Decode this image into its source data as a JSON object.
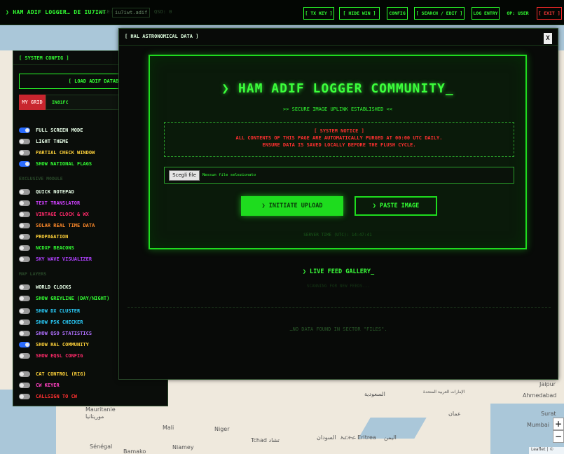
{
  "topbar": {
    "brand": "❯ HAM ADIF LOGGER… DE IU7IWT",
    "file": "iu7iwt.adif",
    "dim_left": "FILE:",
    "dim_right": "QSO: 0",
    "buttons": [
      "[ TX KEY ]",
      "[ HIDE WIN ]",
      "CONFIG",
      "[ SEARCH / EDIT ]",
      "LOG ENTRY",
      "OP: USER",
      "[ EXIT ]"
    ],
    "colors": {
      "accent": "#33ff33",
      "exit": "#ff3a3a"
    }
  },
  "config": {
    "title": "[ SYSTEM CONFIG ]",
    "load_db": "[ LOAD ADIF DATABASE",
    "grid_label": "MY GRID",
    "grid_value": "IN81FC",
    "group1": [
      {
        "label": "FULL SCREEN MODE",
        "on": true,
        "color": "#e8ffe8"
      },
      {
        "label": "LIGHT THEME",
        "on": false,
        "color": "#e8ffe8"
      },
      {
        "label": "PARTIAL CHECK WINDOW",
        "on": false,
        "color": "#ffd23a"
      },
      {
        "label": "SHOW NATIONAL FLAGS",
        "on": true,
        "color": "#33ff33"
      }
    ],
    "section2": "EXCLUSIVE MODULE",
    "group2": [
      {
        "label": "QUICK NOTEPAD",
        "on": false,
        "color": "#e8ffe8"
      },
      {
        "label": "TEXT TRANSLATOR",
        "on": false,
        "color": "#d040ff"
      },
      {
        "label": "VINTAGE CLOCK & WX",
        "on": false,
        "color": "#ff2a6a"
      },
      {
        "label": "SOLAR REAL TIME DATA",
        "on": false,
        "color": "#ff8a2a"
      },
      {
        "label": "PROPAGATION",
        "on": false,
        "color": "#ffd23a"
      },
      {
        "label": "NCDXF BEACONS",
        "on": false,
        "color": "#33ff33"
      },
      {
        "label": "SKY WAVE VISUALIZER",
        "on": false,
        "color": "#b040ff"
      }
    ],
    "section3": "MAP LAYERS",
    "group3": [
      {
        "label": "WORLD CLOCKS",
        "on": false,
        "color": "#e8ffe8"
      },
      {
        "label": "SHOW GREYLINE (DAY/NIGHT)",
        "on": false,
        "color": "#33ff33"
      }
    ],
    "group4": [
      {
        "label": "SHOW DX CLUSTER",
        "on": false,
        "color": "#2ad0ff"
      },
      {
        "label": "SHOW PSK CHECKER",
        "on": false,
        "color": "#2ad0ff"
      },
      {
        "label": "SHOW QSO STATISTICS",
        "on": false,
        "color": "#b070ff"
      },
      {
        "label": "SHOW HAL COMMUNITY",
        "on": true,
        "color": "#ffd23a"
      },
      {
        "label": "SHOW EQSL CONFIG",
        "on": false,
        "color": "#ff2a6a"
      }
    ],
    "group5": [
      {
        "label": "CAT CONTROL (RIG)",
        "on": false,
        "color": "#ffd23a"
      },
      {
        "label": "CW KEYER",
        "on": false,
        "color": "#ff40c0"
      },
      {
        "label": "CALLSIGN TO CW",
        "on": false,
        "color": "#ff3030"
      }
    ]
  },
  "modal": {
    "title": "[ HAL ASTRONOMICAL DATA ]",
    "close": "X",
    "heading": "❯ HAM ADIF LOGGER COMMUNITY_",
    "subheading": ">> SECURE IMAGE UPLINK ESTABLISHED <<",
    "notice_title": "[ SYSTEM NOTICE ]",
    "notice_line1": "ALL CONTENTS OF THIS PAGE ARE AUTOMATICALLY PURGED AT 00:00 UTC DAILY.",
    "notice_line2": "ENSURE DATA IS SAVED LOCALLY BEFORE THE FLUSH CYCLE.",
    "file_button": "Scegli file",
    "file_name": "Nessun file selezionato",
    "upload_button": "❯ INITIATE UPLOAD",
    "paste_button": "❯ PASTE IMAGE",
    "server_time": "SERVER TIME (UTC): 14:47:41",
    "gallery_title": "❯ LIVE FEED GALLERY_",
    "gallery_sub": "SCANNING FOR NEW FEEDS...",
    "no_data": "…NO DATA FOUND IN SECTOR \"FILES\"."
  },
  "map": {
    "places": [
      "Mauritanie",
      "موريتانيا",
      "Mali",
      "Niger",
      "Tchad تشاد",
      "السودان",
      "Sénégal",
      "Bamako",
      "Niamey",
      "ኤርትራ Eritrea",
      "اليمن",
      "السعودية",
      "الإمارات العربية المتحدة",
      "Jaipur",
      "Ahmedabad",
      "Surat",
      "Mumbai",
      "عمان"
    ],
    "attribution": "Leaflet | ©"
  }
}
